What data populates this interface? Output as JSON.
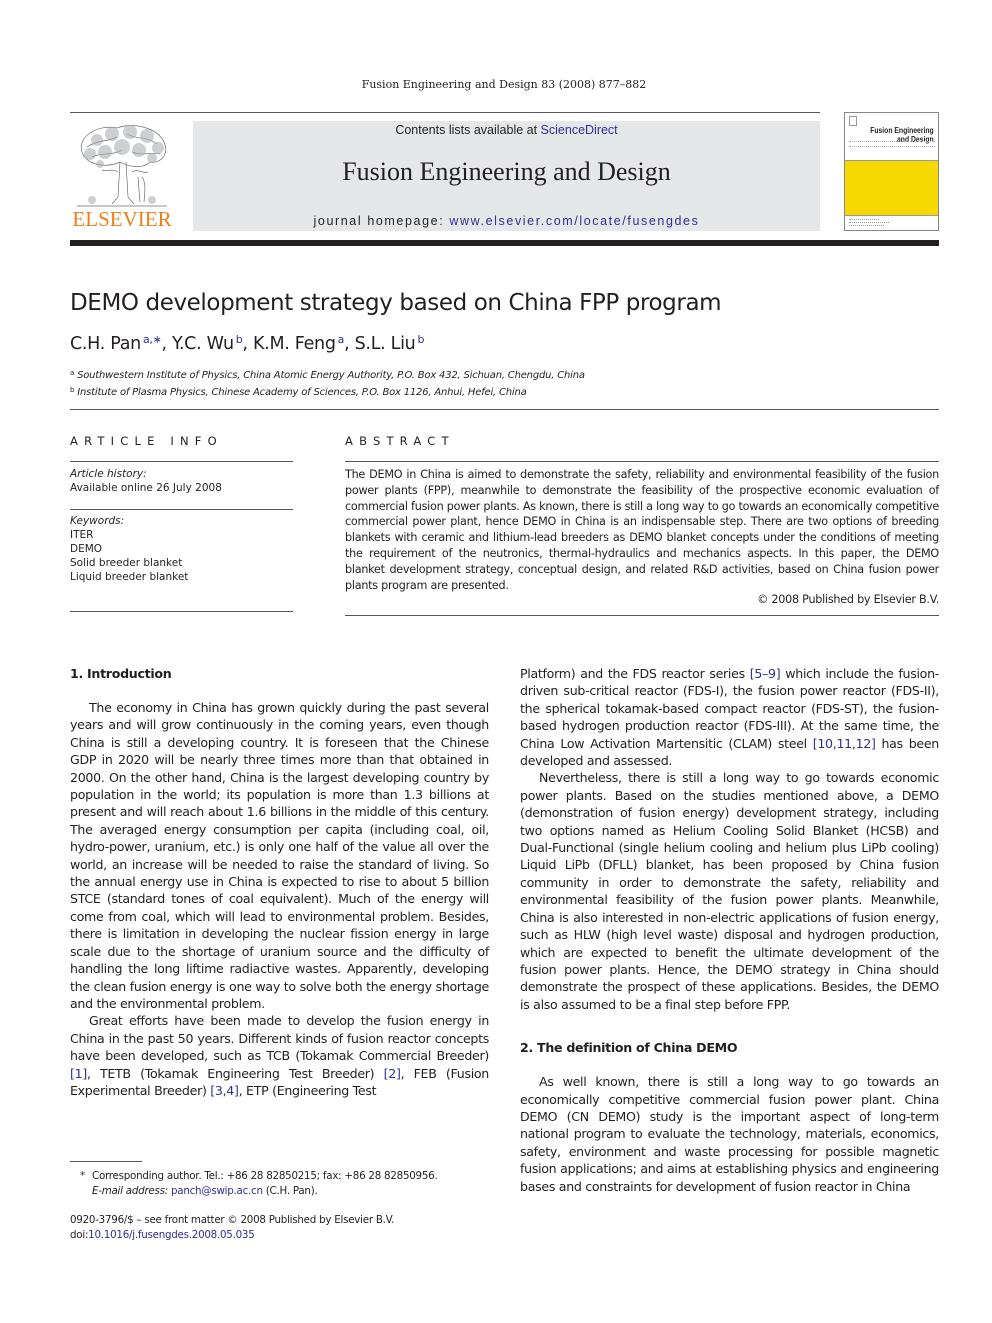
{
  "running_head": "Fusion Engineering and Design 83 (2008) 877–882",
  "publisher": {
    "logo_icon": "elsevier-tree-icon",
    "wordmark": "ELSEVIER",
    "brand_color": "#f07f1b"
  },
  "masthead": {
    "contents_prefix": "Contents lists available at ",
    "contents_link": "ScienceDirect",
    "journal_name": "Fusion Engineering and Design",
    "homepage_prefix": "journal homepage: ",
    "homepage_link": "www.elsevier.com/locate/fusengdes",
    "background_color": "#e6e7e8",
    "link_color": "#2e3192"
  },
  "cover": {
    "title_line1": "Fusion Engineering",
    "title_line2": "and Design",
    "accent_color": "#f5d900"
  },
  "article": {
    "title": "DEMO development strategy based on China FPP program",
    "authors": [
      {
        "name": "C.H. Pan",
        "sup": "a,∗"
      },
      {
        "name": "Y.C. Wu",
        "sup": "b"
      },
      {
        "name": "K.M. Feng",
        "sup": "a"
      },
      {
        "name": "S.L. Liu",
        "sup": "b"
      }
    ],
    "affiliations": [
      {
        "mark": "a",
        "text": "Southwestern Institute of Physics, China Atomic Energy Authority, P.O. Box 432, Sichuan, Chengdu, China"
      },
      {
        "mark": "b",
        "text": "Institute of Plasma Physics, Chinese Academy of Sciences, P.O. Box 1126, Anhui, Hefei, China"
      }
    ]
  },
  "article_info": {
    "heading": "ARTICLE INFO",
    "history_label": "Article history:",
    "history_value": "Available online 26 July 2008",
    "keywords_label": "Keywords:",
    "keywords": [
      "ITER",
      "DEMO",
      "Solid breeder blanket",
      "Liquid breeder blanket"
    ]
  },
  "abstract": {
    "heading": "ABSTRACT",
    "text": "The DEMO in China is aimed to demonstrate the safety, reliability and environmental feasibility of the fusion power plants (FPP), meanwhile to demonstrate the feasibility of the prospective economic evaluation of commercial fusion power plants. As known, there is still a long way to go towards an economically competitive commercial power plant, hence DEMO in China is an indispensable step. There are two options of breeding blankets with ceramic and lithium-lead breeders as DEMO blanket concepts under the conditions of meeting the requirement of the neutronics, thermal-hydraulics and mechanics aspects. In this paper, the DEMO blanket development strategy, conceptual design, and related R&D activities, based on China fusion power plants program are presented.",
    "copyright": "© 2008 Published by Elsevier B.V."
  },
  "body": {
    "section1_heading": "1.  Introduction",
    "s1_p1": "The economy in China has grown quickly during the past several years and will grow continuously in the coming years, even though China is still a developing country. It is foreseen that the Chinese GDP in 2020 will be nearly three times more than that obtained in 2000. On the other hand, China is the largest developing country by population in the world; its population is more than 1.3 billions at present and will reach about 1.6 billions in the middle of this century. The averaged energy consumption per capita (including coal, oil, hydro-power, uranium, etc.) is only one half of the value all over the world, an increase will be needed to raise the standard of living. So the annual energy use in China is expected to rise to about 5 billion STCE (standard tones of coal equivalent). Much of the energy will come from coal, which will lead to environmental problem. Besides, there is limitation in developing the nuclear fission energy in large scale due to the shortage of uranium source and the difficulty of handling the long liftime radiactive wastes. Apparently, developing the clean fusion energy is one way to solve both the energy shortage and the environmental problem.",
    "s1_p2_a": "Great efforts have been made to develop the fusion energy in China in the past 50 years. Different kinds of fusion reactor concepts have been developed, such as TCB (Tokamak Commercial Breeder) ",
    "ref1": "[1]",
    "s1_p2_b": ", TETB (Tokamak Engineering Test Breeder) ",
    "ref2": "[2]",
    "s1_p2_c": ", FEB (Fusion Experimental Breeder) ",
    "ref3": "[3,4]",
    "s1_p2_d": ", ETP (Engineering Test Platform) and the FDS reactor series ",
    "ref4": "[5–9]",
    "s1_p2_e": " which include the fusion-driven sub-critical reactor (FDS-I), the fusion power reactor (FDS-II), the spherical tokamak-based compact reactor (FDS-ST), the fusion-based hydrogen production reactor (FDS-III). At the same time, the China Low Activation Martensitic (CLAM) steel ",
    "ref5": "[10,11,12]",
    "s1_p2_f": " has been developed and assessed.",
    "s1_p3": "Nevertheless, there is still a long way to go towards economic power plants. Based on the studies mentioned above, a DEMO (demonstration of fusion energy) development strategy, including two options named as Helium Cooling Solid Blanket (HCSB) and Dual-Functional (single helium cooling and helium plus LiPb cooling) Liquid LiPb (DFLL) blanket, has been proposed by China fusion community in order to demonstrate the safety, reliability and environmental feasibility of the fusion power plants. Meanwhile, China is also interested in non-electric applications of fusion energy, such as HLW (high level waste) disposal and hydrogen production, which are expected to benefit the ultimate development of the fusion power plants. Hence, the DEMO strategy in China should demonstrate the prospect of these applications. Besides, the DEMO is also assumed to be a final step before FPP.",
    "section2_heading": "2.  The definition of China DEMO",
    "s2_p1": "As well known, there is still a long way to go towards an economically competitive commercial fusion power plant. China DEMO (CN DEMO) study is the important aspect of long-term national program to evaluate the technology, materials, economics, safety, environment and waste processing for possible magnetic fusion applications; and aims at establishing physics and engineering bases and constraints for development of fusion reactor in China"
  },
  "footnotes": {
    "star": "*",
    "corresponding": "Corresponding author. Tel.: +86 28 82850215; fax: +86 28 82850956.",
    "email_label": "E-mail address:",
    "email": "panch@swip.ac.cn",
    "email_suffix": " (C.H. Pan)."
  },
  "front_matter": {
    "issn_line": "0920-3796/$ – see front matter © 2008 Published by Elsevier B.V.",
    "doi_prefix": "doi:",
    "doi": "10.1016/j.fusengdes.2008.05.035"
  }
}
